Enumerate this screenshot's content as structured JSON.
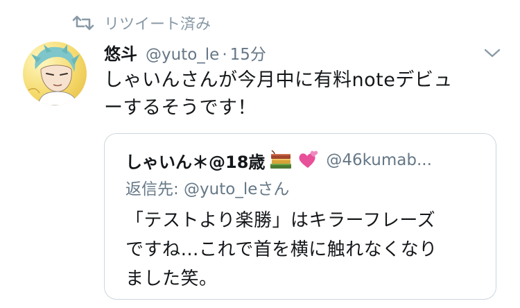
{
  "retweet": {
    "icon": "retweet-icon",
    "label": "リツイート済み"
  },
  "tweet": {
    "avatar_icon": "user-avatar",
    "name": "悠斗",
    "handle": "@yuto_le",
    "separator": "·",
    "time": "15分",
    "menu_icon": "chevron-down-icon",
    "text_lines": [
      "しゃいんさんが今月中に有料noteデビュ",
      "ーするそうです！"
    ]
  },
  "quote": {
    "name": "しゃいん＊@18歳",
    "emoji_icons": [
      "books-icon",
      "two-hearts-icon"
    ],
    "handle": "@46kumab...",
    "reply_to": "返信先: @yuto_leさん",
    "text_lines": [
      "「テストより楽勝」はキラーフレーズ",
      "ですね…これで首を横に触れなくなり",
      "ました笑。"
    ]
  },
  "colors": {
    "muted": "#657786",
    "icon_gray": "#8899a6",
    "border": "#ccd6dd",
    "text": "#14171a"
  }
}
